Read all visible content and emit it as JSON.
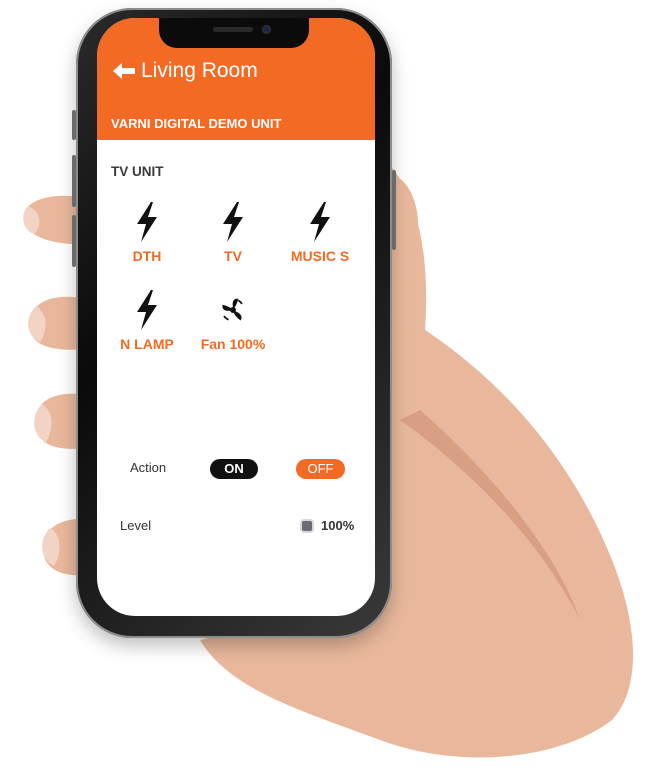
{
  "header": {
    "title": "Living Room",
    "subtitle": "VARNI DIGITAL DEMO UNIT"
  },
  "section": {
    "title": "TV UNIT"
  },
  "devices": [
    {
      "label": "DTH",
      "icon": "lightning-icon"
    },
    {
      "label": "TV",
      "icon": "lightning-icon"
    },
    {
      "label": "MUSIC S",
      "icon": "lightning-icon"
    },
    {
      "label": "N LAMP",
      "icon": "lightning-icon"
    },
    {
      "label": "Fan 100%",
      "icon": "fan-icon"
    }
  ],
  "controls": {
    "action_label": "Action",
    "on_label": "ON",
    "off_label": "OFF",
    "level_label": "Level",
    "level_value": "100%",
    "level_fraction": 1.0
  },
  "colors": {
    "accent": "#f26a23",
    "on_button": "#111111",
    "screen_bg": "#ffffff"
  }
}
